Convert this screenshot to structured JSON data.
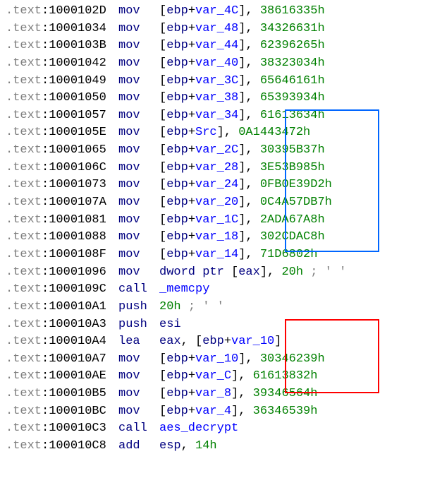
{
  "lines": [
    {
      "addr": "1000102D",
      "mnem": "mov",
      "dest_type": "mem_var",
      "dest": "var_4C",
      "imm": "38616335h"
    },
    {
      "addr": "10001034",
      "mnem": "mov",
      "dest_type": "mem_var",
      "dest": "var_48",
      "imm": "34326631h"
    },
    {
      "addr": "1000103B",
      "mnem": "mov",
      "dest_type": "mem_var",
      "dest": "var_44",
      "imm": "62396265h"
    },
    {
      "addr": "10001042",
      "mnem": "mov",
      "dest_type": "mem_var",
      "dest": "var_40",
      "imm": "38323034h"
    },
    {
      "addr": "10001049",
      "mnem": "mov",
      "dest_type": "mem_var",
      "dest": "var_3C",
      "imm": "65646161h"
    },
    {
      "addr": "10001050",
      "mnem": "mov",
      "dest_type": "mem_var",
      "dest": "var_38",
      "imm": "65393934h"
    },
    {
      "addr": "10001057",
      "mnem": "mov",
      "dest_type": "mem_var",
      "dest": "var_34",
      "imm": "61613634h"
    },
    {
      "addr": "1000105E",
      "mnem": "mov",
      "dest_type": "mem_src",
      "dest": "Src",
      "imm": "0A1443472h"
    },
    {
      "addr": "10001065",
      "mnem": "mov",
      "dest_type": "mem_var",
      "dest": "var_2C",
      "imm": "30395B37h"
    },
    {
      "addr": "1000106C",
      "mnem": "mov",
      "dest_type": "mem_var",
      "dest": "var_28",
      "imm": "3E53B985h"
    },
    {
      "addr": "10001073",
      "mnem": "mov",
      "dest_type": "mem_var",
      "dest": "var_24",
      "imm": "0FB0E39D2h"
    },
    {
      "addr": "1000107A",
      "mnem": "mov",
      "dest_type": "mem_var",
      "dest": "var_20",
      "imm": "0C4A57DB7h"
    },
    {
      "addr": "10001081",
      "mnem": "mov",
      "dest_type": "mem_var",
      "dest": "var_1C",
      "imm": "2ADA67A8h"
    },
    {
      "addr": "10001088",
      "mnem": "mov",
      "dest_type": "mem_var",
      "dest": "var_18",
      "imm": "302CDAC8h"
    },
    {
      "addr": "1000108F",
      "mnem": "mov",
      "dest_type": "mem_var",
      "dest": "var_14",
      "imm": "71D6802h"
    },
    {
      "addr": "10001096",
      "mnem": "mov",
      "dest_type": "dword_ptr_reg",
      "dest": "eax",
      "imm": "20h",
      "comment": "; ' '"
    },
    {
      "addr": "1000109C",
      "mnem": "call",
      "op_type": "ref",
      "op": "_memcpy"
    },
    {
      "addr": "100010A1",
      "mnem": "push",
      "op_type": "imm",
      "op": "20h",
      "comment": "; ' '"
    },
    {
      "addr": "100010A3",
      "mnem": "push",
      "op_type": "reg",
      "op": "esi"
    },
    {
      "addr": "100010A4",
      "mnem": "lea",
      "dest_type": "reg",
      "dest_reg": "eax",
      "src_type": "mem_var",
      "src": "var_10"
    },
    {
      "addr": "100010A7",
      "mnem": "mov",
      "dest_type": "mem_var",
      "dest": "var_10",
      "imm": "30346239h"
    },
    {
      "addr": "100010AE",
      "mnem": "mov",
      "dest_type": "mem_var",
      "dest": "var_C",
      "imm": "61613832h"
    },
    {
      "addr": "100010B5",
      "mnem": "mov",
      "dest_type": "mem_var",
      "dest": "var_8",
      "imm": "39346564h"
    },
    {
      "addr": "100010BC",
      "mnem": "mov",
      "dest_type": "mem_var",
      "dest": "var_4",
      "imm": "36346539h"
    },
    {
      "addr": "100010C3",
      "mnem": "call",
      "op_type": "ref",
      "op": "aes_decrypt"
    },
    {
      "addr": "100010C8",
      "mnem": "add",
      "dest_type": "reg",
      "dest_reg": "esp",
      "imm": "14h"
    }
  ],
  "seg": ".text"
}
